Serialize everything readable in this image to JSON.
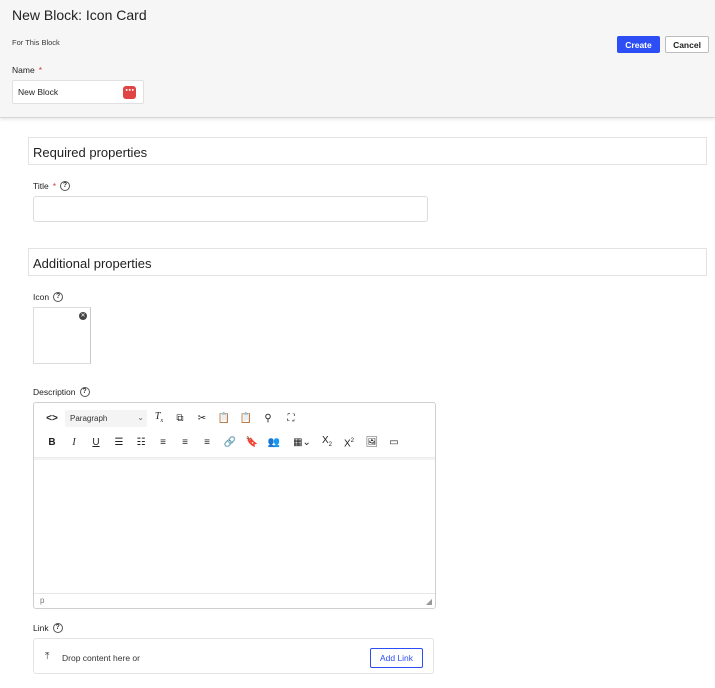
{
  "header": {
    "title": "New Block: Icon Card",
    "subtitle": "For This Block",
    "create_label": "Create",
    "cancel_label": "Cancel",
    "name_label": "Name",
    "required_mark": "*",
    "name_value": "New Block",
    "name_badge": "⋯"
  },
  "sections": {
    "required": "Required properties",
    "additional": "Additional properties"
  },
  "fields": {
    "title_label": "Title",
    "icon_label": "Icon",
    "description_label": "Description",
    "link_label": "Link",
    "help_glyph": "?"
  },
  "editor": {
    "format_select": "Paragraph",
    "status_path": "p",
    "toolbar_row1": [
      "code-view",
      "format-select",
      "clear-format",
      "copy",
      "cut",
      "paste",
      "paste-text",
      "find",
      "fullscreen"
    ],
    "toolbar_row2": [
      "bold",
      "italic",
      "underline",
      "bullet-list",
      "numbered-list",
      "align-left",
      "align-center",
      "align-right",
      "link",
      "bookmark",
      "personalize",
      "table",
      "subscript",
      "superscript",
      "image",
      "media"
    ]
  },
  "link": {
    "drop_text": "Drop content here or",
    "add_label": "Add Link"
  },
  "colors": {
    "accent": "#2d4ef5",
    "required": "#d23a3a",
    "badge": "#e04545"
  }
}
